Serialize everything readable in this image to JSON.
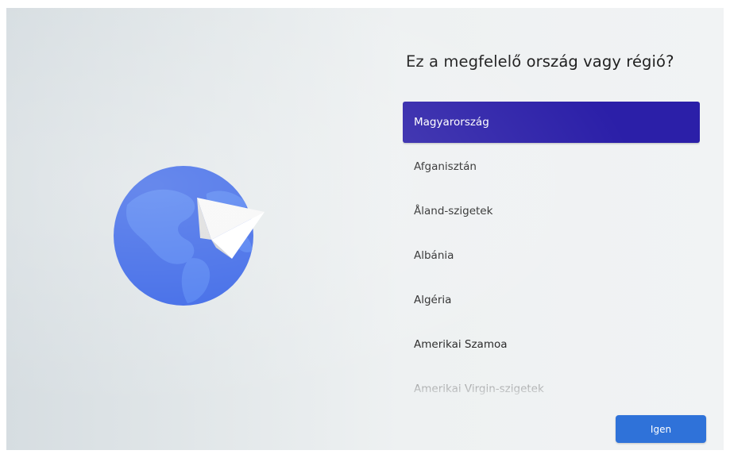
{
  "heading": "Ez a megfelelő ország vagy régió?",
  "countries": [
    {
      "label": "Magyarország",
      "selected": true
    },
    {
      "label": "Afganisztán",
      "selected": false
    },
    {
      "label": "Åland-szigetek",
      "selected": false
    },
    {
      "label": "Albánia",
      "selected": false
    },
    {
      "label": "Algéria",
      "selected": false
    },
    {
      "label": "Amerikai Szamoa",
      "selected": false
    },
    {
      "label": "Amerikai Virgin-szigetek",
      "selected": false
    }
  ],
  "buttons": {
    "confirm_label": "Igen"
  },
  "colors": {
    "selected_row": "#2b1fa8",
    "primary_button": "#2f72d9",
    "globe": "#3461e6"
  },
  "illustration": {
    "icons": [
      "globe-icon",
      "paper-plane-icon"
    ]
  }
}
